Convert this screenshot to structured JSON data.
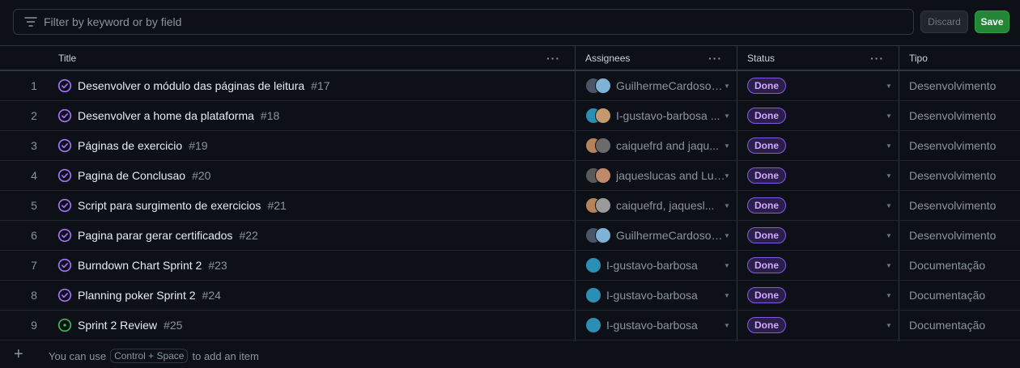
{
  "filter": {
    "placeholder": "Filter by keyword or by field",
    "discard_label": "Discard",
    "save_label": "Save"
  },
  "columns": {
    "title": "Title",
    "assignees": "Assignees",
    "status": "Status",
    "tipo": "Tipo"
  },
  "rows": [
    {
      "num": "1",
      "title": "Desenvolver o módulo das páginas de leitura",
      "issue": "#17",
      "state": "closed",
      "assignees": "GuilhermeCardoso0...",
      "avatars": [
        "#4a5568",
        "#7fb3d5"
      ],
      "status": "Done",
      "tipo": "Desenvolvimento"
    },
    {
      "num": "2",
      "title": "Desenvolver a home da plataforma",
      "issue": "#18",
      "state": "closed",
      "assignees": "I-gustavo-barbosa ...",
      "avatars": [
        "#2b8fb5",
        "#c49a6c"
      ],
      "status": "Done",
      "tipo": "Desenvolvimento"
    },
    {
      "num": "3",
      "title": "Páginas de exercicio",
      "issue": "#19",
      "state": "closed",
      "assignees": "caiquefrd and jaqu...",
      "avatars": [
        "#b5835a",
        "#6b6b6b"
      ],
      "status": "Done",
      "tipo": "Desenvolvimento"
    },
    {
      "num": "4",
      "title": "Pagina de Conclusao",
      "issue": "#20",
      "state": "closed",
      "assignees": "jaqueslucas and Luc...",
      "avatars": [
        "#5a5a5a",
        "#c08a6a"
      ],
      "status": "Done",
      "tipo": "Desenvolvimento"
    },
    {
      "num": "5",
      "title": "Script para surgimento de exercicios",
      "issue": "#21",
      "state": "closed",
      "assignees": "caiquefrd, jaquesl...",
      "avatars": [
        "#b5835a",
        "#9a9a9a"
      ],
      "status": "Done",
      "tipo": "Desenvolvimento"
    },
    {
      "num": "6",
      "title": "Pagina parar gerar certificados",
      "issue": "#22",
      "state": "closed",
      "assignees": "GuilhermeCardoso0...",
      "avatars": [
        "#4a5568",
        "#7fb3d5"
      ],
      "status": "Done",
      "tipo": "Desenvolvimento"
    },
    {
      "num": "7",
      "title": "Burndown Chart Sprint 2",
      "issue": "#23",
      "state": "closed",
      "assignees": "I-gustavo-barbosa",
      "avatars": [
        "#2b8fb5"
      ],
      "status": "Done",
      "tipo": "Documentação"
    },
    {
      "num": "8",
      "title": "Planning poker Sprint 2",
      "issue": "#24",
      "state": "closed",
      "assignees": "I-gustavo-barbosa",
      "avatars": [
        "#2b8fb5"
      ],
      "status": "Done",
      "tipo": "Documentação"
    },
    {
      "num": "9",
      "title": "Sprint 2 Review",
      "issue": "#25",
      "state": "open",
      "assignees": "I-gustavo-barbosa",
      "avatars": [
        "#2b8fb5"
      ],
      "status": "Done",
      "tipo": "Documentação"
    }
  ],
  "footer": {
    "prefix": "You can use",
    "shortcut": "Control + Space",
    "suffix": "to add an item"
  },
  "colors": {
    "closed_icon": "#a371f7",
    "open_icon": "#3fb950",
    "done_badge": "#8957e5"
  }
}
